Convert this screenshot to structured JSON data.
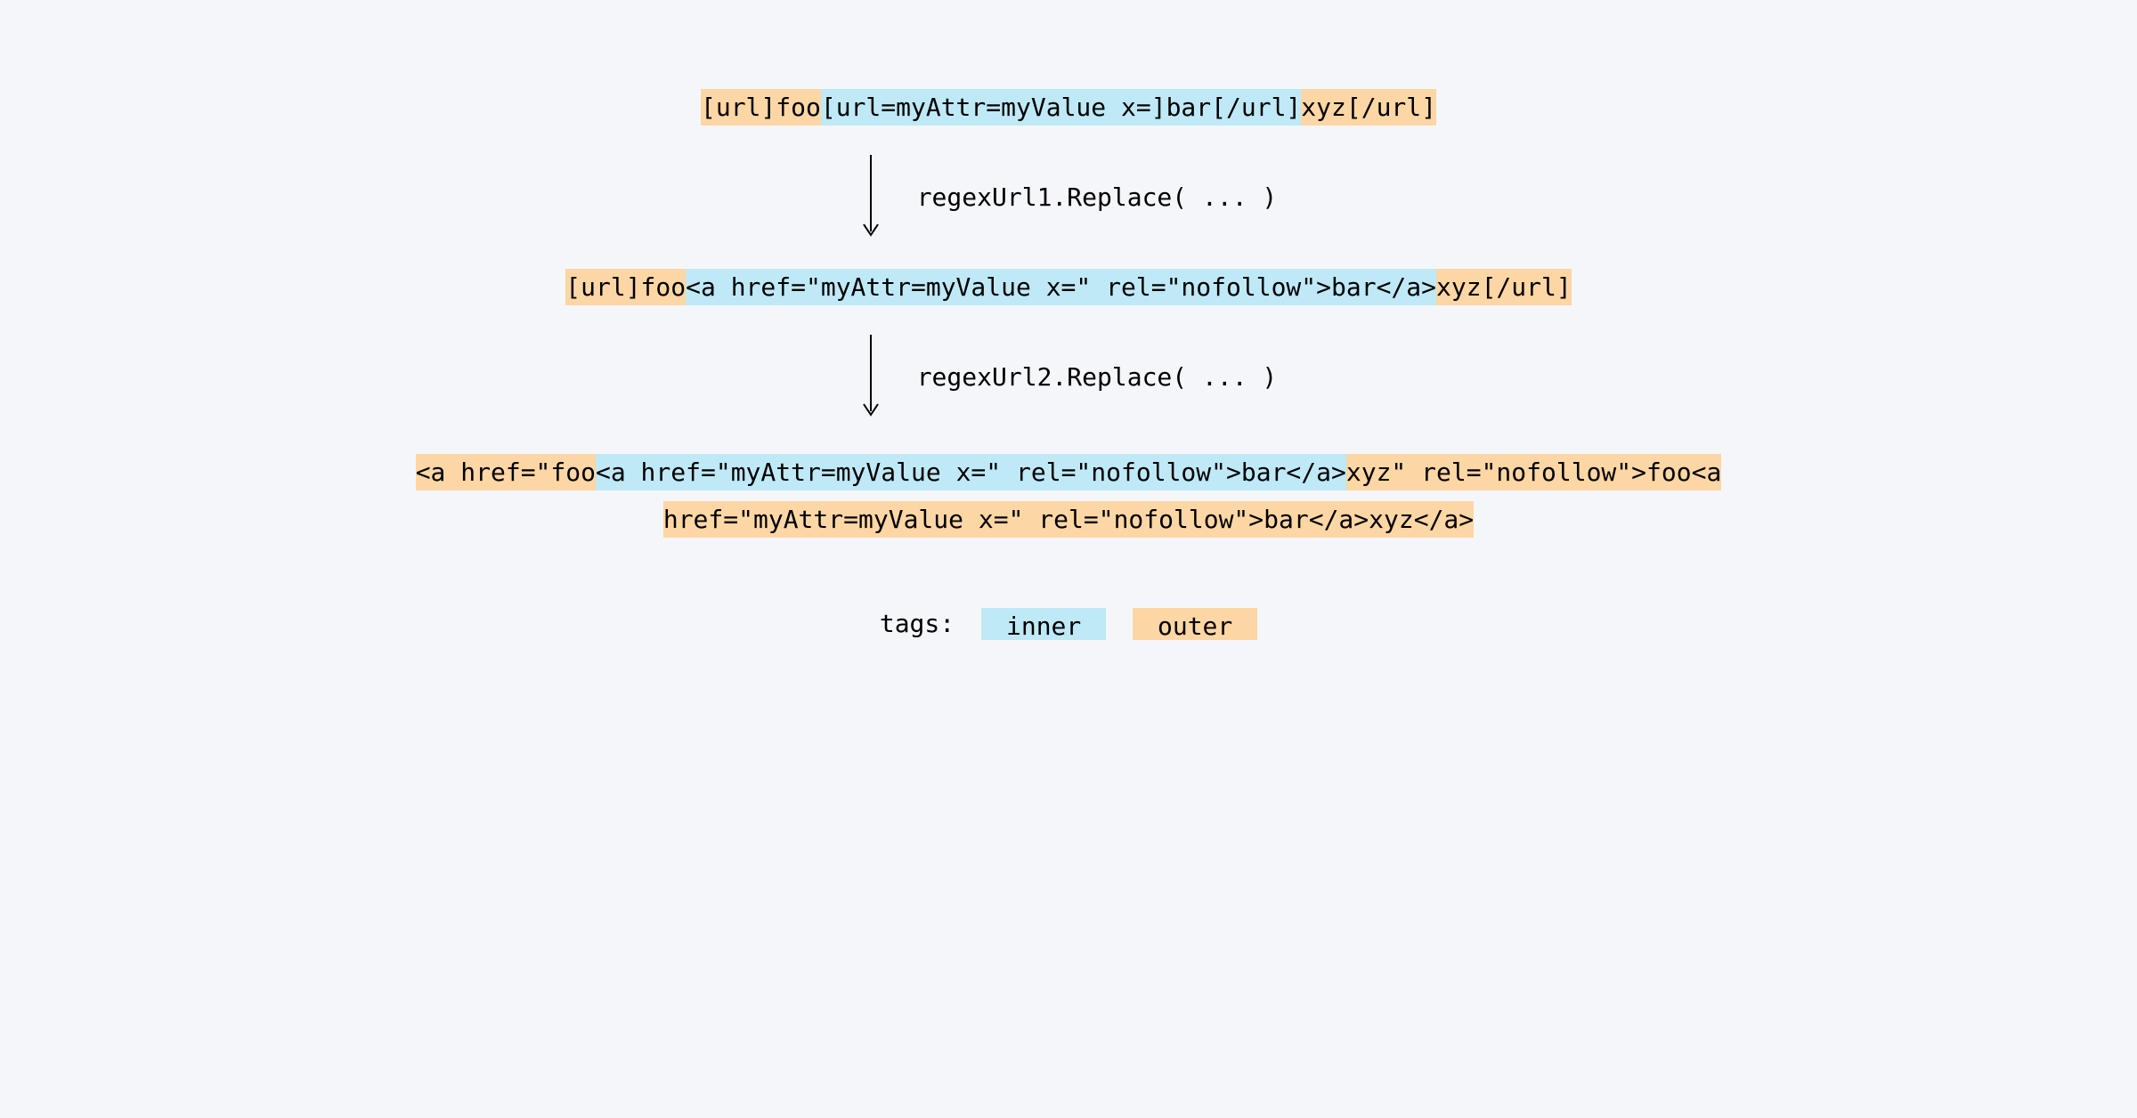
{
  "colors": {
    "inner": "#bfe9f7",
    "outer": "#fcd6a4",
    "bg": "#f5f6fa"
  },
  "row1": {
    "outer_open": "[url]foo",
    "inner": "[url=myAttr=myValue x=]bar[/url]",
    "outer_close": "xyz[/url]"
  },
  "step1_label": "regexUrl1.Replace( ... )",
  "row2": {
    "outer_open": "[url]foo",
    "inner": "<a href=\"myAttr=myValue x=\" rel=\"nofollow\">bar</a>",
    "outer_close": "xyz[/url]"
  },
  "step2_label": "regexUrl2.Replace( ... )",
  "row3": {
    "outer_open": "<a href=\"foo",
    "inner": "<a href=\"myAttr=myValue x=\" rel=\"nofollow\">bar</a>",
    "outer_rest": "xyz\" rel=\"nofollow\">foo<a href=\"myAttr=myValue x=\" rel=\"nofollow\">bar</a>xyz</a>"
  },
  "legend": {
    "title": "tags:",
    "inner_label": "inner",
    "outer_label": "outer"
  }
}
